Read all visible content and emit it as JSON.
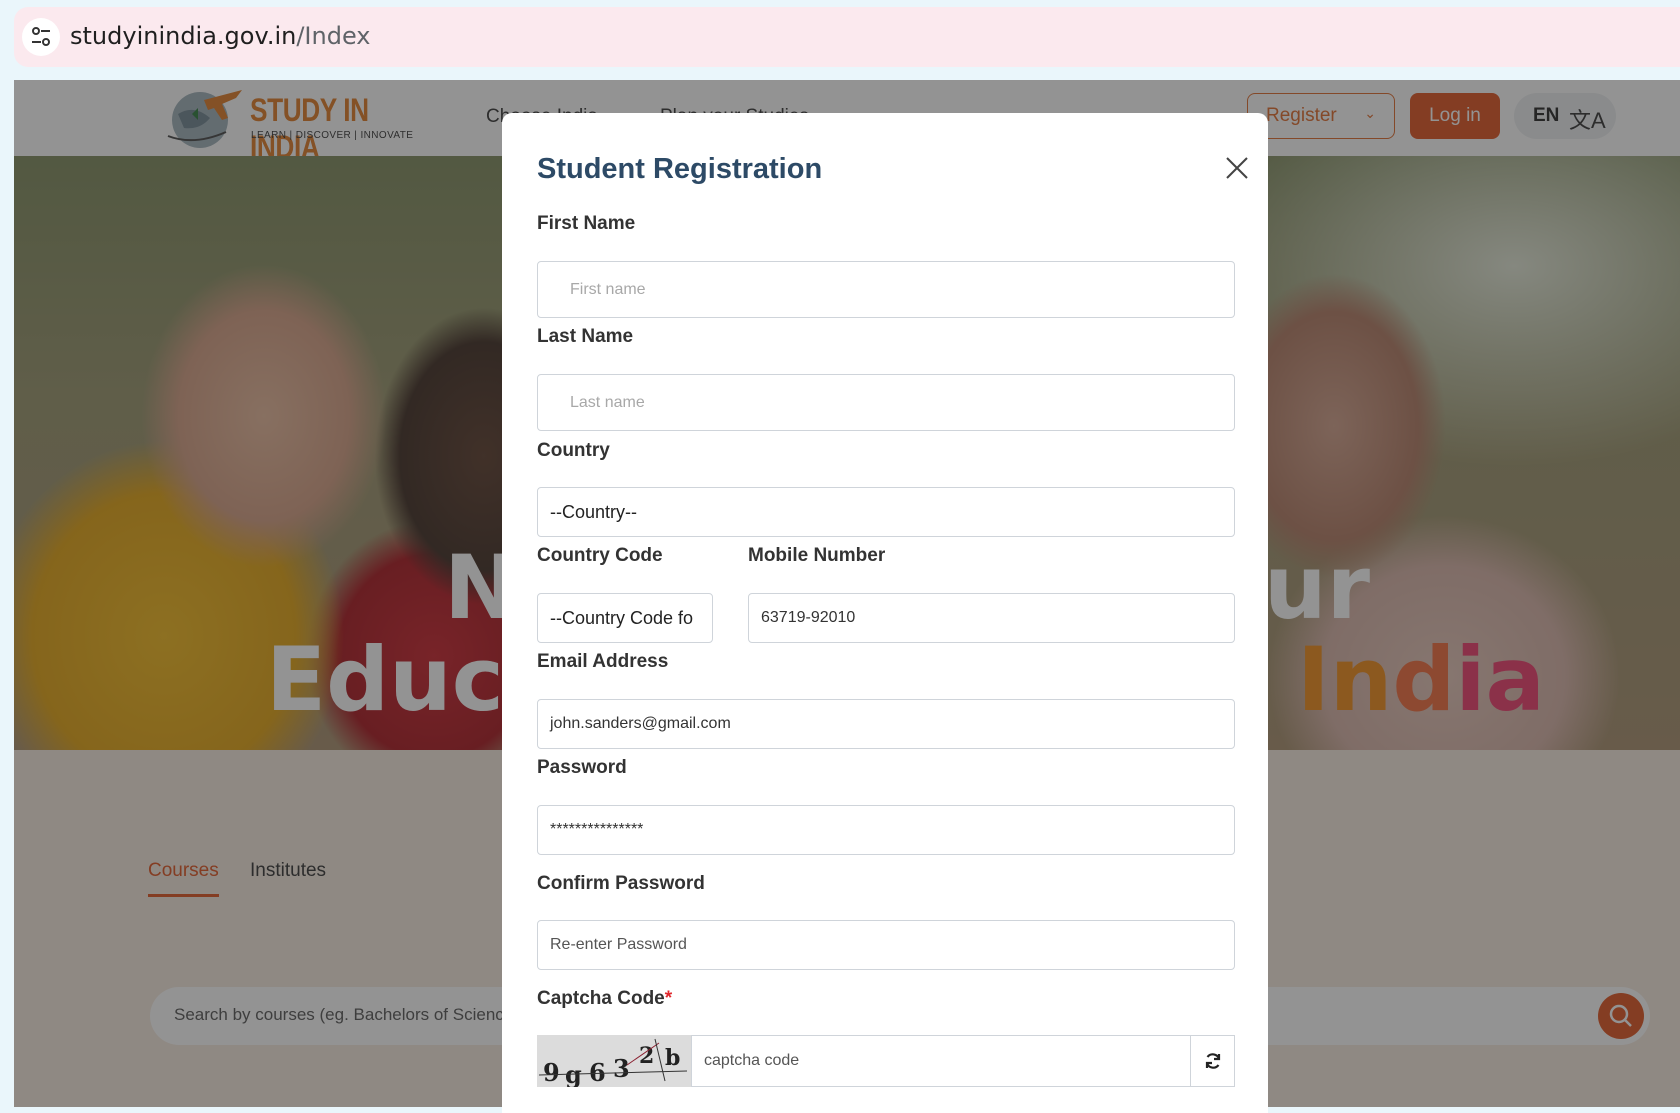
{
  "browser": {
    "url_domain": "studyinindia.gov.in",
    "url_path": "/Index"
  },
  "header": {
    "logo_title": "STUDY IN INDIA",
    "logo_subtitle": "LEARN | DISCOVER | INNOVATE",
    "nav": [
      {
        "label": "Choose India"
      },
      {
        "label": "Plan your Studies"
      }
    ],
    "register_label": "Register",
    "login_label": "Log in",
    "language": "EN"
  },
  "hero": {
    "line1_start": "N",
    "line1_end": "ur",
    "line2_start": "Educa",
    "india_1": "In",
    "india_2": "d",
    "india_3": "ia"
  },
  "search": {
    "tabs": [
      {
        "label": "Courses",
        "active": true
      },
      {
        "label": "Institutes",
        "active": false
      }
    ],
    "placeholder": "Search by courses (eg. Bachelors of Scienc"
  },
  "modal": {
    "title": "Student Registration",
    "first_name": {
      "label": "First Name",
      "placeholder": "First name",
      "value": ""
    },
    "last_name": {
      "label": "Last Name",
      "placeholder": "Last name",
      "value": ""
    },
    "country": {
      "label": "Country",
      "selected": "--Country--"
    },
    "country_code": {
      "label": "Country Code",
      "selected": "--Country Code fo"
    },
    "mobile": {
      "label": "Mobile Number",
      "value": "63719-92010"
    },
    "email": {
      "label": "Email Address",
      "value": "john.sanders@gmail.com"
    },
    "password": {
      "label": "Password",
      "value": "***************"
    },
    "confirm_password": {
      "label": "Confirm Password",
      "placeholder": "Re-enter Password"
    },
    "captcha": {
      "label": "Captcha Code",
      "required_mark": "*",
      "image_text": "9g63 2b",
      "placeholder": "captcha code"
    }
  },
  "colors": {
    "brand_orange": "#e0531f",
    "modal_title": "#2d4a66",
    "required": "#e0262b"
  }
}
